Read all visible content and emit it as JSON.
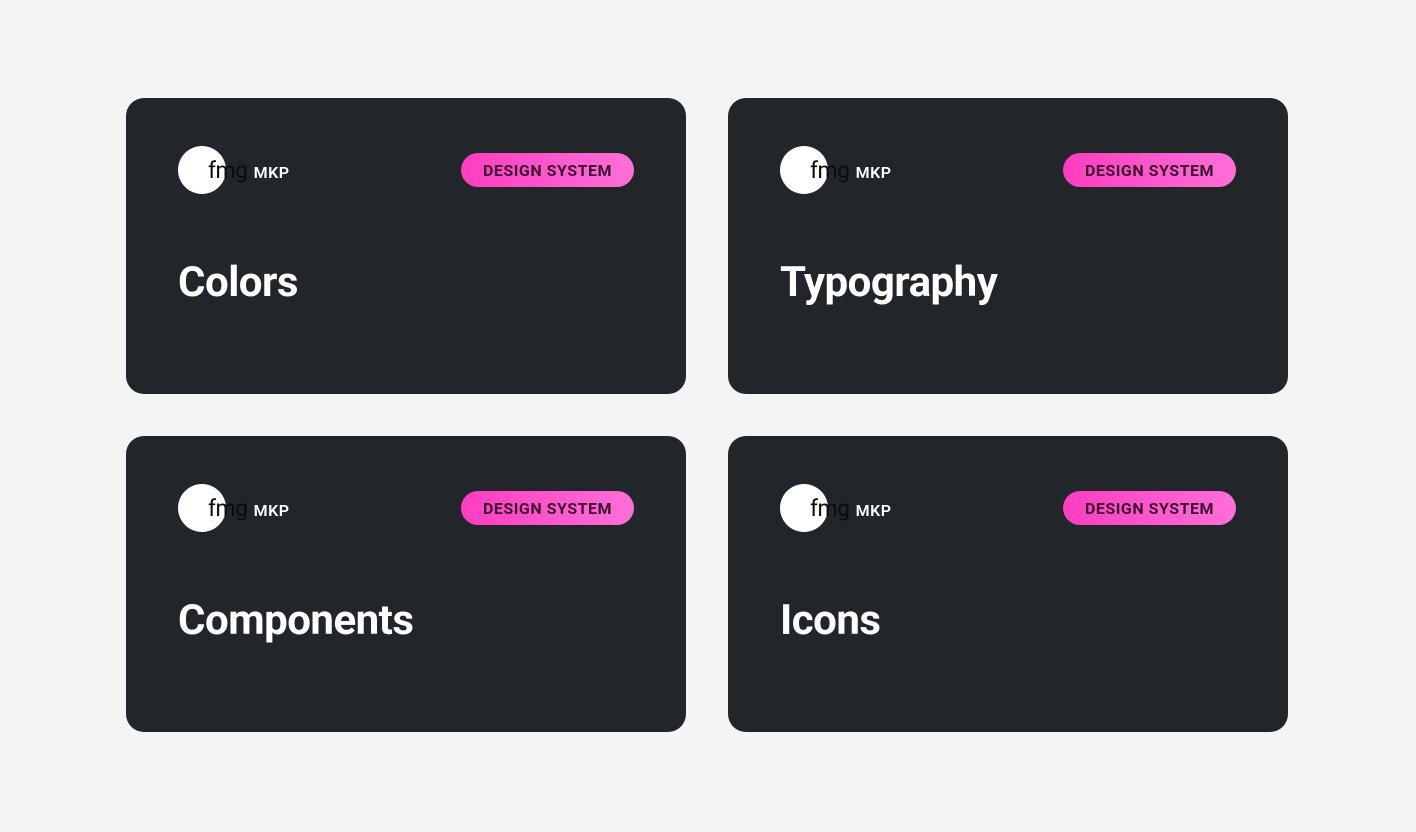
{
  "logo": {
    "fmg": "fmg",
    "mkp": "MKP"
  },
  "badge_label": "DESIGN SYSTEM",
  "cards": [
    {
      "title": "Colors",
      "name": "card-colors"
    },
    {
      "title": "Typography",
      "name": "card-typography"
    },
    {
      "title": "Components",
      "name": "card-components"
    },
    {
      "title": "Icons",
      "name": "card-icons"
    }
  ],
  "colors": {
    "card_bg": "#22252a",
    "page_bg": "#f4f4f4",
    "accent_pink_start": "#ff3dc0",
    "accent_pink_end": "#ff6fd8",
    "badge_text": "#3a0f2f",
    "fg": "#ffffff"
  }
}
